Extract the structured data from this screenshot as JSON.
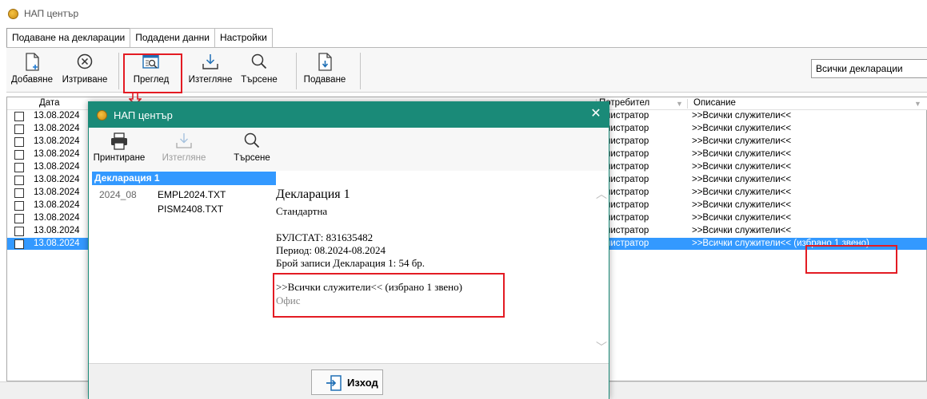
{
  "window": {
    "title": "НАП център"
  },
  "tabs": [
    {
      "label": "Подаване на декларации",
      "active": true
    },
    {
      "label": "Подадени данни",
      "active": false
    },
    {
      "label": "Настройки",
      "active": false
    }
  ],
  "toolbar": {
    "add": "Добавяне",
    "delete": "Изтриване",
    "preview": "Преглед",
    "download": "Изтегляне",
    "search": "Търсене",
    "submit": "Подаване",
    "filter_value": "Всички декларации"
  },
  "grid": {
    "headers": {
      "date": "Дата",
      "user": "Потребител",
      "description": "Описание"
    },
    "rows": [
      {
        "date": "13.08.2024",
        "user": "нистратор",
        "description": ">>Всички служители<<"
      },
      {
        "date": "13.08.2024",
        "user": "нистратор",
        "description": ">>Всички служители<<"
      },
      {
        "date": "13.08.2024",
        "user": "нистратор",
        "description": ">>Всички служители<<"
      },
      {
        "date": "13.08.2024",
        "user": "нистратор",
        "description": ">>Всички служители<<"
      },
      {
        "date": "13.08.2024",
        "user": "нистратор",
        "description": ">>Всички служители<<"
      },
      {
        "date": "13.08.2024",
        "user": "нистратор",
        "description": ">>Всички служители<<"
      },
      {
        "date": "13.08.2024",
        "user": "нистратор",
        "description": ">>Всички служители<<"
      },
      {
        "date": "13.08.2024",
        "user": "нистратор",
        "description": ">>Всички служители<<"
      },
      {
        "date": "13.08.2024",
        "user": "нистратор",
        "description": ">>Всички служители<<"
      },
      {
        "date": "13.08.2024",
        "user": "нистратор",
        "description": ">>Всички служители<<"
      },
      {
        "date": "13.08.2024",
        "user": "нистратор",
        "description": ">>Всички служители<< (избрано 1 звено)",
        "selected": true
      }
    ]
  },
  "dialog": {
    "title": "НАП център",
    "close": "✕",
    "toolbar": {
      "print": "Принтиране",
      "download": "Изтегляне",
      "search": "Търсене"
    },
    "tree": {
      "selected": "Декларация 1",
      "period": "2024_08",
      "files": [
        "EMPL2024.TXT",
        "PISM2408.TXT"
      ]
    },
    "preview": {
      "title": "Декларация 1",
      "subtitle": "Стандартна",
      "bulstat": "БУЛСТАТ: 831635482",
      "period": "Период: 08.2024-08.2024",
      "records": "Брой записи Декларация 1: 54 бр.",
      "selection": ">>Всички служители<< (избрано 1 звено)",
      "unit": "Офис"
    },
    "exit": "Изход"
  },
  "colors": {
    "accent": "#1a8a78",
    "selection": "#3399ff",
    "annotation": "#e31b23"
  }
}
